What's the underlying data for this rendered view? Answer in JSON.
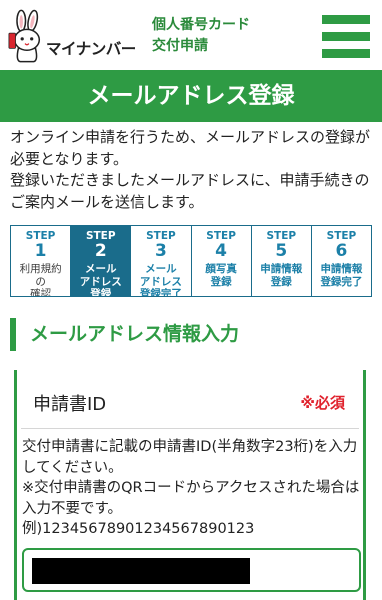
{
  "header": {
    "logo_text": "マイナンバー",
    "logo_icon": "mascot-rabbit-icon",
    "title_line1": "個人番号カード",
    "title_line2": "交付申請",
    "menu_icon": "hamburger-menu-icon"
  },
  "banner": {
    "title": "メールアドレス登録"
  },
  "intro": {
    "paragraphs": [
      "オンライン申請を行うため、メールアドレスの登録が必要となります。",
      "登録いただきましたメールアドレスに、申請手続きのご案内メールを送信します。"
    ]
  },
  "steps": [
    {
      "label": "STEP",
      "number": "1",
      "lines": [
        "利用規約",
        "の",
        "確認"
      ]
    },
    {
      "label": "STEP",
      "number": "2",
      "lines": [
        "メール",
        "アドレス",
        "登録"
      ]
    },
    {
      "label": "STEP",
      "number": "3",
      "lines": [
        "メール",
        "アドレス",
        "登録完了"
      ]
    },
    {
      "label": "STEP",
      "number": "4",
      "lines": [
        "顔写真",
        "登録"
      ]
    },
    {
      "label": "STEP",
      "number": "5",
      "lines": [
        "申請情報",
        "登録"
      ]
    },
    {
      "label": "STEP",
      "number": "6",
      "lines": [
        "申請情報",
        "登録完了"
      ]
    }
  ],
  "section": {
    "heading": "メールアドレス情報入力"
  },
  "form": {
    "field_label": "申請書ID",
    "required_label": "※必須",
    "help_paragraphs": [
      "交付申請書に記載の申請書ID(半角数字23桁)を入力してください。",
      "※交付申請書のQRコードからアクセスされた場合は入力不要です。",
      "例)12345678901234567890123"
    ]
  },
  "colors": {
    "brand_green": "#2e9b44",
    "header_green": "#2a8a3a",
    "step_teal": "#1c80a8",
    "step_active": "#1a6c8b",
    "required_red": "#e0222d"
  }
}
